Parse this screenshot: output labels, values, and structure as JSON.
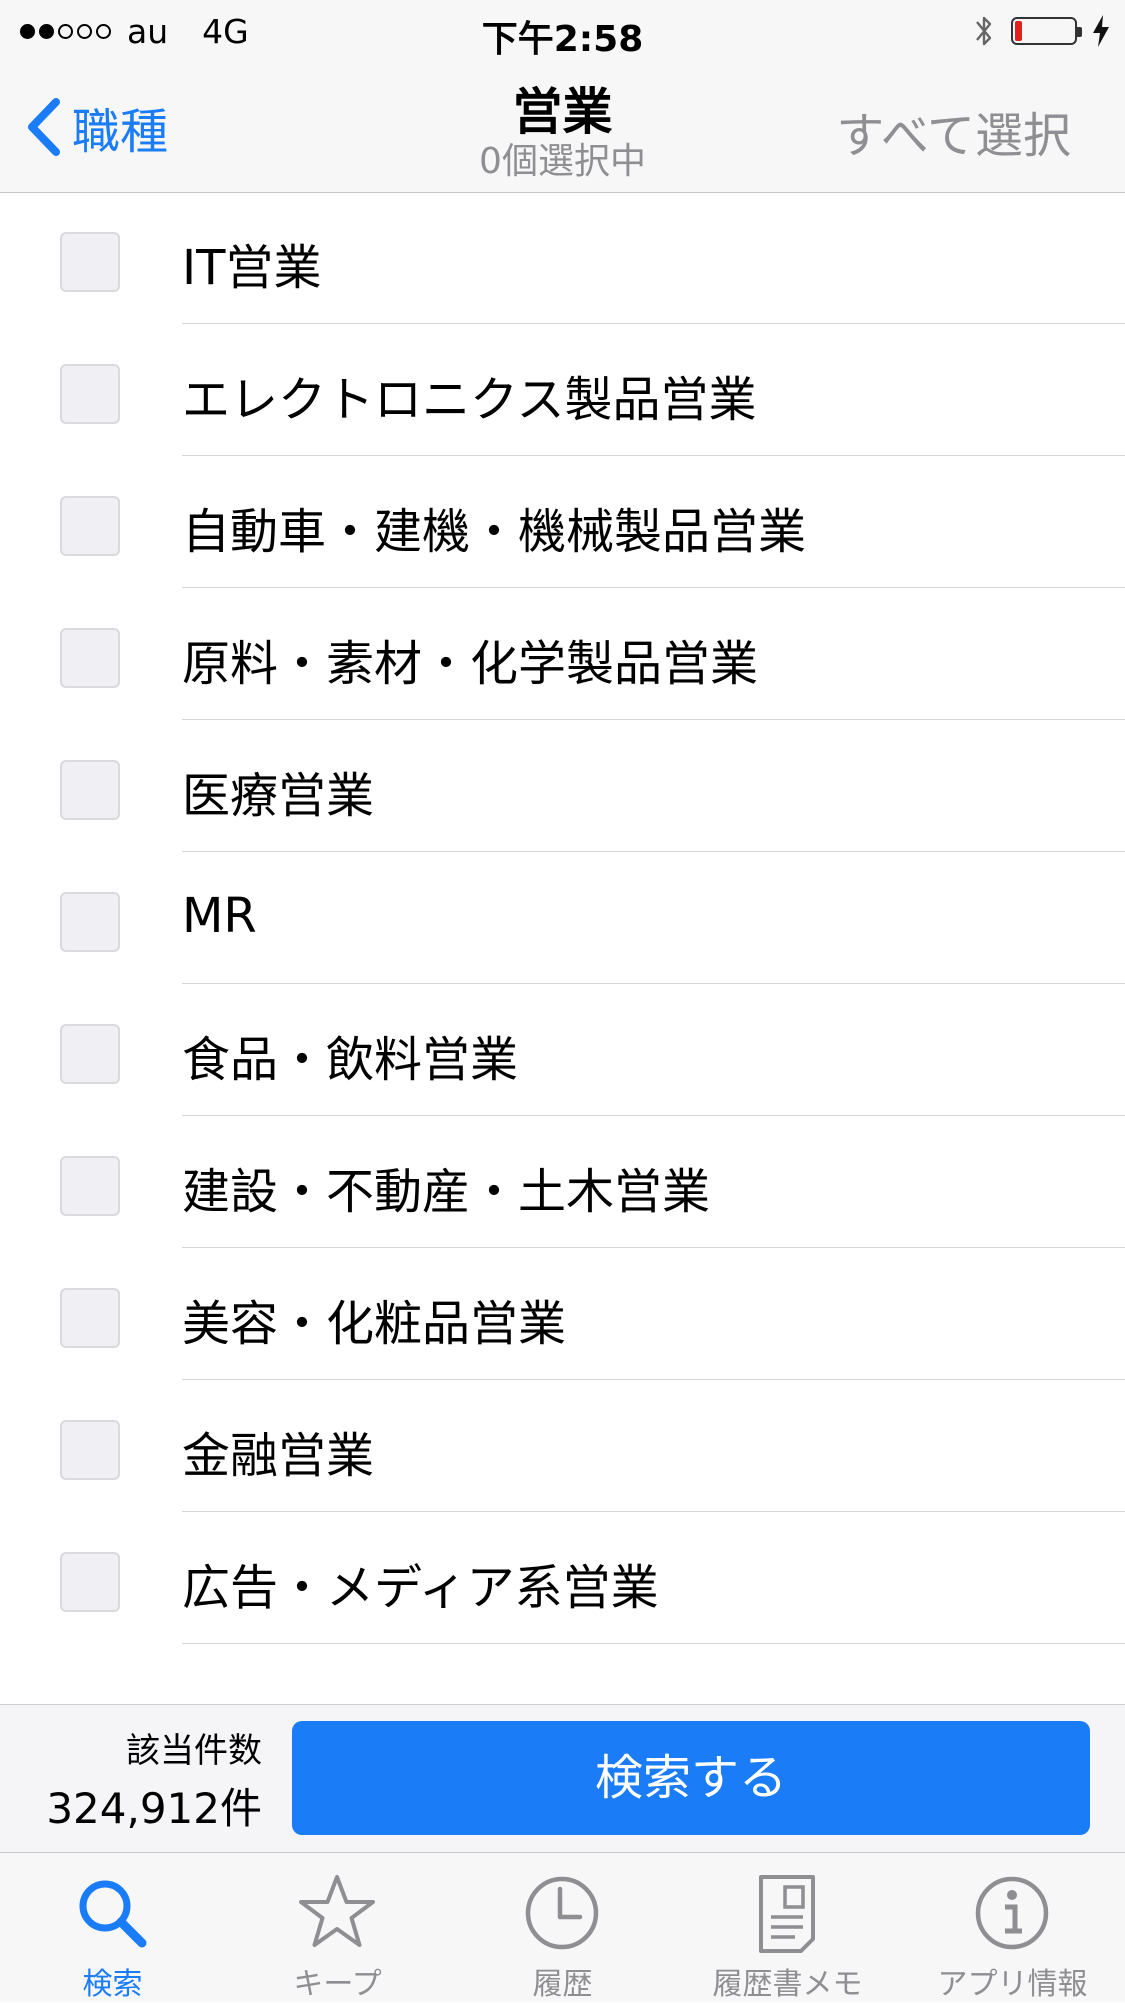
{
  "status_bar": {
    "carrier": "au",
    "network": "4G",
    "time": "下午2:58",
    "signal_bars_filled": 2,
    "signal_bars_total": 5,
    "battery_level": 0.12,
    "battery_color": "#e0211b",
    "charging": true,
    "bluetooth": true
  },
  "nav": {
    "back_label": "職種",
    "title": "営業",
    "subtitle": "0個選択中",
    "select_all_label": "すべて選択",
    "accent_color": "#1a7cf7"
  },
  "list": {
    "items": [
      {
        "label": "IT営業",
        "checked": false
      },
      {
        "label": "エレクトロニクス製品営業",
        "checked": false
      },
      {
        "label": "自動車・建機・機械製品営業",
        "checked": false
      },
      {
        "label": "原料・素材・化学製品営業",
        "checked": false
      },
      {
        "label": "医療営業",
        "checked": false
      },
      {
        "label": "MR",
        "checked": false
      },
      {
        "label": "食品・飲料営業",
        "checked": false
      },
      {
        "label": "建設・不動産・土木営業",
        "checked": false
      },
      {
        "label": "美容・化粧品営業",
        "checked": false
      },
      {
        "label": "金融営業",
        "checked": false
      },
      {
        "label": "広告・メディア系営業",
        "checked": false
      }
    ]
  },
  "search_bar": {
    "count_label": "該当件数",
    "count_value": "324,912件",
    "search_button_label": "検索する"
  },
  "tab_bar": {
    "tabs": [
      {
        "label": "検索",
        "icon": "search-icon",
        "active": true
      },
      {
        "label": "キープ",
        "icon": "star-icon",
        "active": false
      },
      {
        "label": "履歴",
        "icon": "clock-icon",
        "active": false
      },
      {
        "label": "履歴書メモ",
        "icon": "document-icon",
        "active": false
      },
      {
        "label": "アプリ情報",
        "icon": "info-icon",
        "active": false
      }
    ]
  }
}
